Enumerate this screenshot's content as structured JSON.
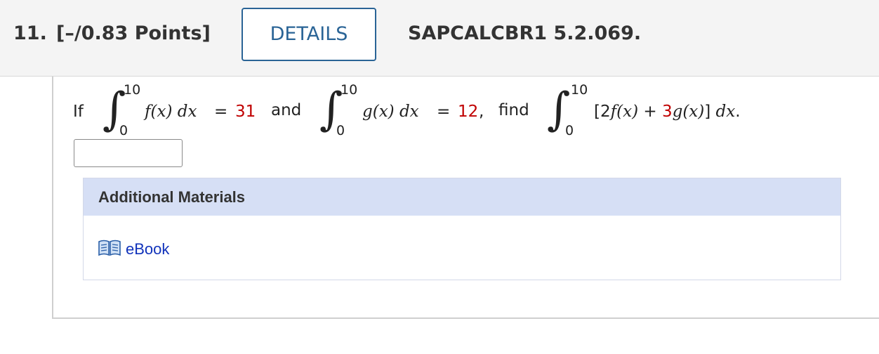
{
  "header": {
    "question_number": "11.",
    "points": "[–/0.83 Points]",
    "details_label": "DETAILS",
    "problem_code": "SAPCALCBR1 5.2.069."
  },
  "question": {
    "if_word": "If",
    "integral_sign": "∫",
    "int1": {
      "upper": "10",
      "lower": "0",
      "integrand": "f(x) dx",
      "equals": "=",
      "value": "31"
    },
    "and_word": "and",
    "int2": {
      "upper": "10",
      "lower": "0",
      "integrand": "g(x) dx",
      "equals": "=",
      "value": "12",
      "comma": ","
    },
    "find_word": "find",
    "int3": {
      "upper": "10",
      "lower": "0",
      "open": "[2",
      "f_part": "f(x)",
      "plus": " + ",
      "coef": "3",
      "g_part": "g(x)",
      "close": "]",
      "dx": " dx",
      "period": "."
    }
  },
  "answer_input": {
    "value": ""
  },
  "additional_materials": {
    "title": "Additional Materials",
    "links": [
      {
        "label": "eBook",
        "icon": "open-book-icon"
      }
    ]
  },
  "colors": {
    "accent_blue": "#2a6496",
    "highlight_red": "#c00000",
    "materials_header": "#d6dff5",
    "link_blue": "#1133bb"
  }
}
